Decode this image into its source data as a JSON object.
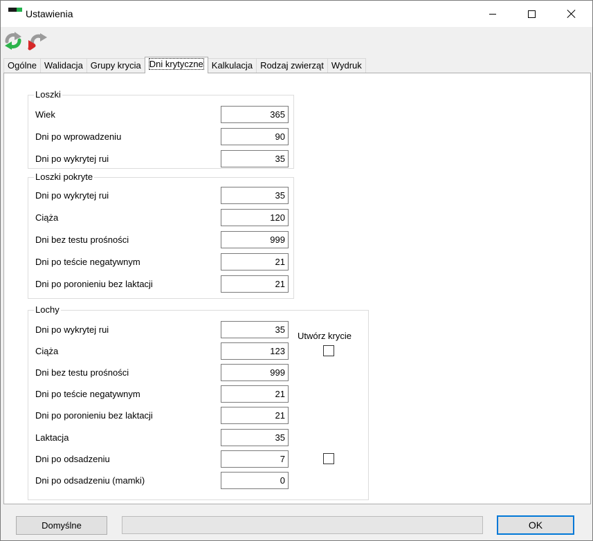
{
  "window": {
    "title": "Ustawienia"
  },
  "toolbar": {
    "refresh_icon": "refresh-icon",
    "undo_icon": "undo-icon"
  },
  "tabs": [
    {
      "label": "Ogólne"
    },
    {
      "label": "Walidacja"
    },
    {
      "label": "Grupy krycia"
    },
    {
      "label": "Dni krytyczne",
      "active": true
    },
    {
      "label": "Kalkulacja"
    },
    {
      "label": "Rodzaj zwierząt"
    },
    {
      "label": "Wydruk"
    }
  ],
  "loszki": {
    "title": "Loszki",
    "rows": [
      {
        "label": "Wiek",
        "value": "365"
      },
      {
        "label": "Dni po wprowadzeniu",
        "value": "90"
      },
      {
        "label": "Dni po wykrytej rui",
        "value": "35"
      }
    ]
  },
  "loszki_pokryte": {
    "title": "Loszki pokryte",
    "rows": [
      {
        "label": "Dni po wykrytej rui",
        "value": "35"
      },
      {
        "label": "Ciąża",
        "value": "120"
      },
      {
        "label": "Dni bez testu prośności",
        "value": "999"
      },
      {
        "label": "Dni po teście negatywnym",
        "value": "21"
      },
      {
        "label": "Dni po poronieniu bez laktacji",
        "value": "21"
      }
    ]
  },
  "lochy": {
    "title": "Lochy",
    "checkbox_header": "Utwórz krycie",
    "rows": [
      {
        "label": "Dni po wykrytej rui",
        "value": "35"
      },
      {
        "label": "Ciąża",
        "value": "123"
      },
      {
        "label": "Dni bez testu prośności",
        "value": "999"
      },
      {
        "label": "Dni po teście negatywnym",
        "value": "21"
      },
      {
        "label": "Dni po poronieniu bez laktacji",
        "value": "21"
      },
      {
        "label": "Laktacja",
        "value": "35"
      },
      {
        "label": "Dni po odsadzeniu",
        "value": "7"
      },
      {
        "label": "Dni po odsadzeniu (mamki)",
        "value": "0"
      }
    ],
    "checkboxes": {
      "ciaza_checked": false,
      "odsadzenie_checked": false
    }
  },
  "footer": {
    "default_label": "Domyślne",
    "ok_label": "OK",
    "progress": 0
  }
}
